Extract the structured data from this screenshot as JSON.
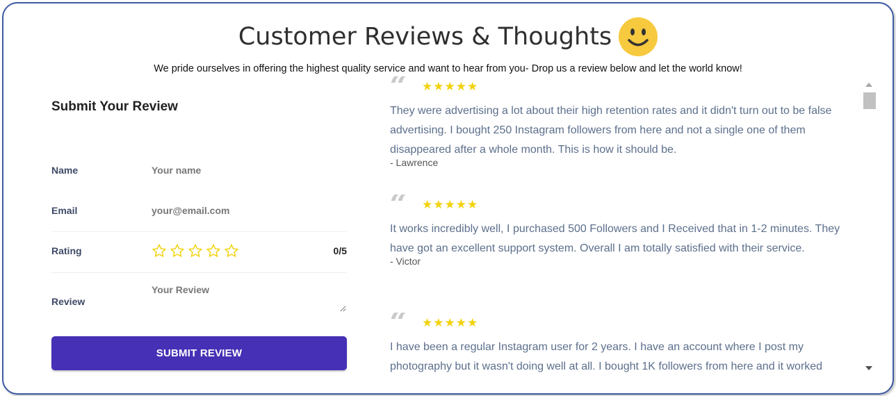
{
  "header": {
    "title": "Customer Reviews & Thoughts",
    "subtitle": "We pride ourselves in offering the highest quality service and want to hear from you- Drop us a review below and let the world know!"
  },
  "form": {
    "title": "Submit Your Review",
    "name_label": "Name",
    "name_placeholder": "Your name",
    "email_label": "Email",
    "email_placeholder": "your@email.com",
    "rating_label": "Rating",
    "rating_value": "0/5",
    "review_label": "Review",
    "review_placeholder": "Your Review",
    "submit_label": "SUBMIT REVIEW"
  },
  "reviews": [
    {
      "stars": "★★★★★",
      "text": "They were advertising a lot about their high retention rates and it didn't turn out to be false advertising. I bought 250 Instagram followers from here and not a single one of them disappeared after a whole month. This is how it should be.",
      "author": "- Lawrence"
    },
    {
      "stars": "★★★★★",
      "text": "It works incredibly well, I purchased 500 Followers and I Received that in 1-2 minutes. They have got an excellent support system. Overall I am totally satisfied with their service.",
      "author": "- Victor"
    },
    {
      "stars": "★★★★★",
      "text": "I have been a regular Instagram user for 2 years. I have an account where I post my photography but it wasn't doing well at all. I bought 1K followers from here and it worked",
      "author": ""
    }
  ],
  "colors": {
    "accent": "#4630b5",
    "star": "#f2d20b",
    "review_text": "#5c6f8c",
    "border": "#3d5aa3"
  },
  "icons": {
    "smiley": "smiley-face-icon",
    "quote": "quote-icon",
    "rating_star": "star-outline-icon"
  }
}
